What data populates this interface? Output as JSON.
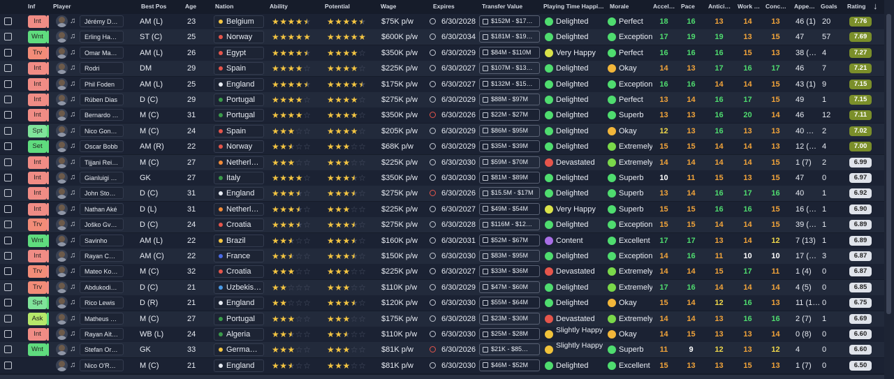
{
  "columns": {
    "inf": "Inf",
    "player": "Player",
    "best_pos": "Best Pos",
    "age": "Age",
    "nation": "Nation",
    "ability": "Ability",
    "potential": "Potential",
    "wage": "Wage",
    "expires": "Expires",
    "transfer_value": "Transfer Value",
    "playing_time": "Playing Time Happin…",
    "morale": "Morale",
    "accel": "Accele…",
    "pace": "Pace",
    "anticip": "Anticip…",
    "work": "Work …",
    "conce": "Conce…",
    "appe": "Appe…",
    "goals": "Goals",
    "rating": "Rating"
  },
  "colors": {
    "delighted": "#4fdc6f",
    "very_happy": "#d9e24a",
    "content": "#a86ee6",
    "devastated": "#e5554b",
    "slightly": "#f0c23a",
    "perfect": "#4fdc6f",
    "exception": "#4fdc6f",
    "superb": "#4fdc6f",
    "excellent": "#4fdc6f",
    "extremely": "#7ad84a",
    "okay": "#f2b63a",
    "very_happy_m": "#4fdc6f"
  },
  "rows": [
    {
      "inf": "Int",
      "name": "Jérémy Doku",
      "pos": "AM (L)",
      "age": "23",
      "nation": "Belgium",
      "flag": "#f4c542",
      "ab": 4.5,
      "pot": 4.5,
      "wage": "$75K p/w",
      "exp": "6/30/2028",
      "clock": "w",
      "tv": "$152M - $17…",
      "pt": "Delighted",
      "pti": "delighted",
      "mo": "Perfect",
      "moi": "perfect",
      "a1": "18",
      "c1": "g",
      "a2": "16",
      "c2": "g",
      "a3": "13",
      "c3": "o",
      "a4": "14",
      "c4": "o",
      "a5": "13",
      "c5": "o",
      "app": "46 (1)",
      "goals": "20",
      "rating": "7.76",
      "rc": "g"
    },
    {
      "inf": "Wnt",
      "name": "Erling Haaland",
      "pos": "ST (C)",
      "age": "25",
      "nation": "Norway",
      "flag": "#e5554b",
      "ab": 5,
      "pot": 5,
      "wage": "$600K p/w",
      "exp": "6/30/2034",
      "clock": "w",
      "tv": "$181M - $19…",
      "pt": "Delighted",
      "pti": "delighted",
      "mo": "Exception",
      "moi": "exception",
      "a1": "17",
      "c1": "g",
      "a2": "19",
      "c2": "g",
      "a3": "19",
      "c3": "g",
      "a4": "13",
      "c4": "o",
      "a5": "15",
      "c5": "o",
      "app": "47",
      "goals": "57",
      "rating": "7.69",
      "rc": "g"
    },
    {
      "inf": "Trv",
      "name": "Omar Marmou…",
      "pos": "AM (L)",
      "age": "26",
      "nation": "Egypt",
      "flag": "#e5554b",
      "ab": 4.5,
      "pot": 4,
      "wage": "$350K p/w",
      "exp": "6/30/2029",
      "clock": "w",
      "tv": "$84M - $110M",
      "pt": "Very Happy",
      "pti": "very_happy",
      "mo": "Perfect",
      "moi": "perfect",
      "a1": "16",
      "c1": "g",
      "a2": "16",
      "c2": "g",
      "a3": "16",
      "c3": "g",
      "a4": "15",
      "c4": "o",
      "a5": "13",
      "c5": "o",
      "app": "38 (…",
      "goals": "4",
      "rating": "7.27",
      "rc": "g"
    },
    {
      "inf": "Int",
      "name": "Rodri",
      "pos": "DM",
      "age": "29",
      "nation": "Spain",
      "flag": "#e5554b",
      "ab": 4,
      "pot": 4,
      "wage": "$225K p/w",
      "exp": "6/30/2027",
      "clock": "w",
      "tv": "$107M - $13…",
      "pt": "Delighted",
      "pti": "delighted",
      "mo": "Okay",
      "moi": "okay",
      "a1": "14",
      "c1": "o",
      "a2": "13",
      "c2": "o",
      "a3": "17",
      "c3": "g",
      "a4": "16",
      "c4": "g",
      "a5": "17",
      "c5": "g",
      "app": "46",
      "goals": "7",
      "rating": "7.21",
      "rc": "g"
    },
    {
      "inf": "Int",
      "name": "Phil Foden",
      "pos": "AM (L)",
      "age": "25",
      "nation": "England",
      "flag": "#e8ecf3",
      "ab": 4.5,
      "pot": 4.5,
      "wage": "$175K p/w",
      "exp": "6/30/2027",
      "clock": "w",
      "tv": "$132M - $15…",
      "pt": "Delighted",
      "pti": "delighted",
      "mo": "Exception",
      "moi": "exception",
      "a1": "16",
      "c1": "g",
      "a2": "16",
      "c2": "g",
      "a3": "14",
      "c3": "o",
      "a4": "14",
      "c4": "o",
      "a5": "15",
      "c5": "o",
      "app": "43 (1)",
      "goals": "9",
      "rating": "7.15",
      "rc": "g"
    },
    {
      "inf": "Int",
      "name": "Rúben Dias",
      "pos": "D (C)",
      "age": "29",
      "nation": "Portugal",
      "flag": "#3a9a4a",
      "ab": 4,
      "pot": 4,
      "wage": "$275K p/w",
      "exp": "6/30/2029",
      "clock": "w",
      "tv": "$88M - $97M",
      "pt": "Delighted",
      "pti": "delighted",
      "mo": "Perfect",
      "moi": "perfect",
      "a1": "13",
      "c1": "o",
      "a2": "14",
      "c2": "o",
      "a3": "16",
      "c3": "g",
      "a4": "17",
      "c4": "g",
      "a5": "15",
      "c5": "o",
      "app": "49",
      "goals": "1",
      "rating": "7.15",
      "rc": "g"
    },
    {
      "inf": "Int",
      "name": "Bernardo Silva",
      "pos": "M (C)",
      "age": "31",
      "nation": "Portugal",
      "flag": "#3a9a4a",
      "ab": 4,
      "pot": 4,
      "wage": "$350K p/w",
      "exp": "6/30/2026",
      "clock": "r",
      "tv": "$22M - $27M",
      "pt": "Delighted",
      "pti": "delighted",
      "mo": "Superb",
      "moi": "superb",
      "a1": "13",
      "c1": "o",
      "a2": "13",
      "c2": "o",
      "a3": "16",
      "c3": "g",
      "a4": "20",
      "c4": "g",
      "a5": "14",
      "c5": "o",
      "app": "46",
      "goals": "12",
      "rating": "7.11",
      "rc": "g"
    },
    {
      "inf": "Spt",
      "name": "Nico González",
      "pos": "M (C)",
      "age": "24",
      "nation": "Spain",
      "flag": "#e5554b",
      "ab": 3,
      "pot": 4,
      "wage": "$205K p/w",
      "exp": "6/30/2029",
      "clock": "w",
      "tv": "$86M - $95M",
      "pt": "Delighted",
      "pti": "delighted",
      "mo": "Okay",
      "moi": "okay",
      "a1": "12",
      "c1": "y",
      "a2": "13",
      "c2": "o",
      "a3": "16",
      "c3": "g",
      "a4": "13",
      "c4": "o",
      "a5": "13",
      "c5": "o",
      "app": "40 …",
      "goals": "2",
      "rating": "7.02",
      "rc": "g"
    },
    {
      "inf": "Set",
      "name": "Oscar Bobb",
      "pos": "AM (R)",
      "age": "22",
      "nation": "Norway",
      "flag": "#e5554b",
      "ab": 2.5,
      "pot": 3,
      "wage": "$68K p/w",
      "exp": "6/30/2029",
      "clock": "w",
      "tv": "$35M - $39M",
      "pt": "Delighted",
      "pti": "delighted",
      "mo": "Extremely",
      "moi": "extremely",
      "a1": "15",
      "c1": "o",
      "a2": "15",
      "c2": "o",
      "a3": "14",
      "c3": "o",
      "a4": "14",
      "c4": "o",
      "a5": "13",
      "c5": "o",
      "app": "12 (…",
      "goals": "4",
      "rating": "7.00",
      "rc": "g"
    },
    {
      "inf": "Int",
      "name": "Tijjani Reijnders",
      "pos": "M (C)",
      "age": "27",
      "nation": "Netherl…",
      "flag": "#f28c38",
      "ab": 3,
      "pot": 3,
      "wage": "$225K p/w",
      "exp": "6/30/2030",
      "clock": "w",
      "tv": "$59M - $70M",
      "pt": "Devastated",
      "pti": "devastated",
      "mo": "Extremely",
      "moi": "extremely",
      "a1": "14",
      "c1": "o",
      "a2": "14",
      "c2": "o",
      "a3": "14",
      "c3": "o",
      "a4": "14",
      "c4": "o",
      "a5": "15",
      "c5": "o",
      "app": "1 (7)",
      "goals": "2",
      "rating": "6.99",
      "rc": "d"
    },
    {
      "inf": "Int",
      "name": "Gianluigi Donna…",
      "pos": "GK",
      "age": "27",
      "nation": "Italy",
      "flag": "#3a9a4a",
      "ab": 4,
      "pot": 3.5,
      "wage": "$350K p/w",
      "exp": "6/30/2030",
      "clock": "w",
      "tv": "$81M - $89M",
      "pt": "Delighted",
      "pti": "delighted",
      "mo": "Superb",
      "moi": "superb",
      "a1": "10",
      "c1": "w",
      "a2": "11",
      "c2": "o",
      "a3": "15",
      "c3": "o",
      "a4": "13",
      "c4": "o",
      "a5": "15",
      "c5": "o",
      "app": "47",
      "goals": "0",
      "rating": "6.97",
      "rc": "d"
    },
    {
      "inf": "Int",
      "name": "John Stones",
      "pos": "D (C)",
      "age": "31",
      "nation": "England",
      "flag": "#e8ecf3",
      "ab": 3.5,
      "pot": 3.5,
      "wage": "$275K p/w",
      "exp": "6/30/2026",
      "clock": "r",
      "tv": "$15.5M - $17M",
      "pt": "Delighted",
      "pti": "delighted",
      "mo": "Superb",
      "moi": "superb",
      "a1": "13",
      "c1": "o",
      "a2": "14",
      "c2": "o",
      "a3": "16",
      "c3": "g",
      "a4": "17",
      "c4": "g",
      "a5": "16",
      "c5": "g",
      "app": "40",
      "goals": "1",
      "rating": "6.92",
      "rc": "d"
    },
    {
      "inf": "Int",
      "name": "Nathan Aké",
      "pos": "D (L)",
      "age": "31",
      "nation": "Netherl…",
      "flag": "#f28c38",
      "ab": 3.5,
      "pot": 3,
      "wage": "$225K p/w",
      "exp": "6/30/2027",
      "clock": "w",
      "tv": "$49M - $54M",
      "pt": "Very Happy",
      "pti": "very_happy",
      "mo": "Superb",
      "moi": "superb",
      "a1": "15",
      "c1": "o",
      "a2": "15",
      "c2": "o",
      "a3": "16",
      "c3": "g",
      "a4": "16",
      "c4": "g",
      "a5": "15",
      "c5": "o",
      "app": "16 (…",
      "goals": "1",
      "rating": "6.90",
      "rc": "d"
    },
    {
      "inf": "Trv",
      "name": "Joško Gvardiol",
      "pos": "D (C)",
      "age": "24",
      "nation": "Croatia",
      "flag": "#e5554b",
      "ab": 3.5,
      "pot": 3.5,
      "wage": "$275K p/w",
      "exp": "6/30/2028",
      "clock": "w",
      "tv": "$116M - $12…",
      "pt": "Delighted",
      "pti": "delighted",
      "mo": "Exception",
      "moi": "exception",
      "a1": "15",
      "c1": "o",
      "a2": "15",
      "c2": "o",
      "a3": "14",
      "c3": "o",
      "a4": "14",
      "c4": "o",
      "a5": "15",
      "c5": "o",
      "app": "39 (…",
      "goals": "1",
      "rating": "6.89",
      "rc": "d"
    },
    {
      "inf": "Wnt",
      "name": "Savinho",
      "pos": "AM (L)",
      "age": "22",
      "nation": "Brazil",
      "flag": "#f4c542",
      "ab": 2.5,
      "pot": 3.5,
      "wage": "$160K p/w",
      "exp": "6/30/2031",
      "clock": "w",
      "tv": "$52M - $67M",
      "pt": "Content",
      "pti": "content",
      "mo": "Excellent",
      "moi": "excellent",
      "a1": "17",
      "c1": "g",
      "a2": "17",
      "c2": "g",
      "a3": "13",
      "c3": "o",
      "a4": "14",
      "c4": "o",
      "a5": "12",
      "c5": "y",
      "app": "7 (13)",
      "goals": "1",
      "rating": "6.89",
      "rc": "d"
    },
    {
      "inf": "Int",
      "name": "Rayan Cherki",
      "pos": "AM (C)",
      "age": "22",
      "nation": "France",
      "flag": "#4a6ae6",
      "ab": 2.5,
      "pot": 3.5,
      "wage": "$150K p/w",
      "exp": "6/30/2030",
      "clock": "w",
      "tv": "$83M - $95M",
      "pt": "Delighted",
      "pti": "delighted",
      "mo": "Exception",
      "moi": "exception",
      "a1": "14",
      "c1": "o",
      "a2": "16",
      "c2": "g",
      "a3": "11",
      "c3": "o",
      "a4": "10",
      "c4": "w",
      "a5": "10",
      "c5": "w",
      "app": "17 (…",
      "goals": "3",
      "rating": "6.87",
      "rc": "d"
    },
    {
      "inf": "Trv",
      "name": "Mateo Kovačić",
      "pos": "M (C)",
      "age": "32",
      "nation": "Croatia",
      "flag": "#e5554b",
      "ab": 3,
      "pot": 3,
      "wage": "$225K p/w",
      "exp": "6/30/2027",
      "clock": "w",
      "tv": "$33M - $36M",
      "pt": "Devastated",
      "pti": "devastated",
      "mo": "Extremely",
      "moi": "extremely",
      "a1": "14",
      "c1": "o",
      "a2": "14",
      "c2": "o",
      "a3": "15",
      "c3": "o",
      "a4": "17",
      "c4": "g",
      "a5": "11",
      "c5": "o",
      "app": "1 (4)",
      "goals": "0",
      "rating": "6.87",
      "rc": "d"
    },
    {
      "inf": "Trv",
      "name": "Abdukodir Khus…",
      "pos": "D (C)",
      "age": "21",
      "nation": "Uzbekis…",
      "flag": "#4a9ae6",
      "ab": 2,
      "pot": 3,
      "wage": "$110K p/w",
      "exp": "6/30/2029",
      "clock": "w",
      "tv": "$47M - $60M",
      "pt": "Delighted",
      "pti": "delighted",
      "mo": "Extremely",
      "moi": "extremely",
      "a1": "17",
      "c1": "g",
      "a2": "16",
      "c2": "g",
      "a3": "14",
      "c3": "o",
      "a4": "14",
      "c4": "o",
      "a5": "14",
      "c5": "o",
      "app": "4 (5)",
      "goals": "0",
      "rating": "6.85",
      "rc": "d"
    },
    {
      "inf": "Spt",
      "name": "Rico Lewis",
      "pos": "D (R)",
      "age": "21",
      "nation": "England",
      "flag": "#e8ecf3",
      "ab": 2,
      "pot": 3.5,
      "wage": "$120K p/w",
      "exp": "6/30/2030",
      "clock": "w",
      "tv": "$55M - $64M",
      "pt": "Delighted",
      "pti": "delighted",
      "mo": "Okay",
      "moi": "okay",
      "a1": "15",
      "c1": "o",
      "a2": "14",
      "c2": "o",
      "a3": "12",
      "c3": "y",
      "a4": "16",
      "c4": "g",
      "a5": "13",
      "c5": "o",
      "app": "11 (1…",
      "goals": "0",
      "rating": "6.75",
      "rc": "d"
    },
    {
      "inf": "Ask",
      "name": "Matheus Nunes",
      "pos": "M (C)",
      "age": "27",
      "nation": "Portugal",
      "flag": "#3a9a4a",
      "ab": 3,
      "pot": 3,
      "wage": "$175K p/w",
      "exp": "6/30/2028",
      "clock": "w",
      "tv": "$23M - $30M",
      "pt": "Devastated",
      "pti": "devastated",
      "mo": "Extremely",
      "moi": "extremely",
      "a1": "14",
      "c1": "o",
      "a2": "14",
      "c2": "o",
      "a3": "13",
      "c3": "o",
      "a4": "16",
      "c4": "g",
      "a5": "16",
      "c5": "g",
      "app": "2 (7)",
      "goals": "1",
      "rating": "6.69",
      "rc": "d"
    },
    {
      "inf": "Int",
      "name": "Rayan Aït-Nouri",
      "pos": "WB (L)",
      "age": "24",
      "nation": "Algeria",
      "flag": "#3a9a4a",
      "ab": 2.5,
      "pot": 2.5,
      "wage": "$110K p/w",
      "exp": "6/30/2030",
      "clock": "w",
      "tv": "$25M - $28M",
      "pt": "Slightly Happy",
      "pti": "slightly",
      "mo": "Okay",
      "moi": "okay",
      "a1": "14",
      "c1": "o",
      "a2": "15",
      "c2": "o",
      "a3": "13",
      "c3": "o",
      "a4": "13",
      "c4": "o",
      "a5": "14",
      "c5": "o",
      "app": "0 (8)",
      "goals": "0",
      "rating": "6.60",
      "rc": "d"
    },
    {
      "inf": "Wnt",
      "name": "Stefan Ortega",
      "pos": "GK",
      "age": "33",
      "nation": "Germa…",
      "flag": "#f4c542",
      "ab": 3,
      "pot": 3,
      "wage": "$81K p/w",
      "exp": "6/30/2026",
      "clock": "r",
      "tv": "$21K - $85…",
      "pt": "Slightly Happy",
      "pti": "slightly",
      "mo": "Superb",
      "moi": "superb",
      "a1": "11",
      "c1": "o",
      "a2": "9",
      "c2": "w",
      "a3": "12",
      "c3": "y",
      "a4": "13",
      "c4": "o",
      "a5": "12",
      "c5": "y",
      "app": "4",
      "goals": "0",
      "rating": "6.60",
      "rc": "d"
    },
    {
      "inf": "",
      "name": "Nico O'Reilly",
      "pos": "M (C)",
      "age": "21",
      "nation": "England",
      "flag": "#e8ecf3",
      "ab": 2.5,
      "pot": 3,
      "wage": "$81K p/w",
      "exp": "6/30/2030",
      "clock": "w",
      "tv": "$46M - $52M",
      "pt": "Delighted",
      "pti": "delighted",
      "mo": "Excellent",
      "moi": "excellent",
      "a1": "15",
      "c1": "o",
      "a2": "13",
      "c2": "o",
      "a3": "13",
      "c3": "o",
      "a4": "15",
      "c4": "o",
      "a5": "13",
      "c5": "o",
      "app": "1 (7)",
      "goals": "0",
      "rating": "6.50",
      "rc": "d"
    }
  ]
}
